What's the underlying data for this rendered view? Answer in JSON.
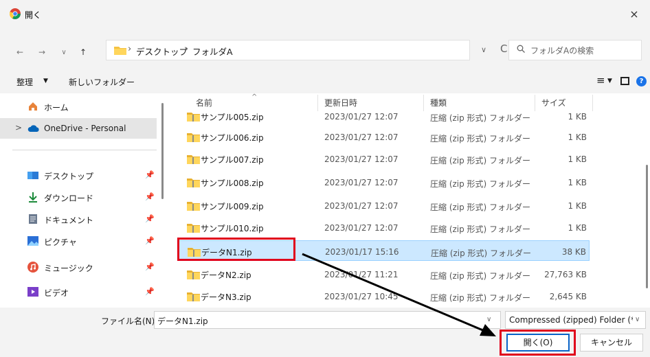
{
  "window": {
    "title": "開く",
    "close_glyph": "×"
  },
  "address": {
    "back": "←",
    "forward": "→",
    "recent": "∨",
    "up": "↑",
    "crumbs": [
      "デスクトップ",
      "フォルダA"
    ],
    "separator": "›",
    "dropdown": "∨",
    "refresh": "C",
    "search_placeholder": "フォルダAの検索"
  },
  "toolbar": {
    "organize": "整理",
    "organize_caret": "▼",
    "new_folder": "新しいフォルダー",
    "view_glyph": "≡",
    "view_caret": "▼",
    "help": "?"
  },
  "nav": {
    "items": [
      {
        "label": "ホーム",
        "icon": "home-icon"
      },
      {
        "label": "OneDrive - Personal",
        "icon": "cloud-icon",
        "expand": ">"
      },
      {
        "label": "デスクトップ",
        "icon": "desktop-icon",
        "pin": "📌"
      },
      {
        "label": "ダウンロード",
        "icon": "download-icon",
        "pin": "📌"
      },
      {
        "label": "ドキュメント",
        "icon": "document-icon",
        "pin": "📌"
      },
      {
        "label": "ピクチャ",
        "icon": "pictures-icon",
        "pin": "📌"
      },
      {
        "label": "ミュージック",
        "icon": "music-icon",
        "pin": "📌"
      },
      {
        "label": "ビデオ",
        "icon": "video-icon",
        "pin": "📌"
      }
    ]
  },
  "columns": {
    "name": "名前",
    "sort_arrow": "^",
    "date": "更新日時",
    "type": "種類",
    "size": "サイズ"
  },
  "files": [
    {
      "name": "サンプル005.zip",
      "date": "2023/01/27 12:07",
      "type": "圧縮 (zip 形式) フォルダー",
      "size": "1 KB"
    },
    {
      "name": "サンプル006.zip",
      "date": "2023/01/27 12:07",
      "type": "圧縮 (zip 形式) フォルダー",
      "size": "1 KB"
    },
    {
      "name": "サンプル007.zip",
      "date": "2023/01/27 12:07",
      "type": "圧縮 (zip 形式) フォルダー",
      "size": "1 KB"
    },
    {
      "name": "サンプル008.zip",
      "date": "2023/01/27 12:07",
      "type": "圧縮 (zip 形式) フォルダー",
      "size": "1 KB"
    },
    {
      "name": "サンプル009.zip",
      "date": "2023/01/27 12:07",
      "type": "圧縮 (zip 形式) フォルダー",
      "size": "1 KB"
    },
    {
      "name": "サンプル010.zip",
      "date": "2023/01/27 12:07",
      "type": "圧縮 (zip 形式) フォルダー",
      "size": "1 KB"
    },
    {
      "name": "データN1.zip",
      "date": "2023/01/17 15:16",
      "type": "圧縮 (zip 形式) フォルダー",
      "size": "38 KB",
      "selected": true
    },
    {
      "name": "データN2.zip",
      "date": "2023/01/27 11:21",
      "type": "圧縮 (zip 形式) フォルダー",
      "size": "27,763 KB"
    },
    {
      "name": "データN3.zip",
      "date": "2023/01/27 10:45",
      "type": "圧縮 (zip 形式) フォルダー",
      "size": "2,645 KB"
    }
  ],
  "bottom": {
    "filename_label": "ファイル名(N):",
    "filename_value": "データN1.zip",
    "dropdown": "∨",
    "filetype_value": "Compressed (zipped) Folder (*.z",
    "open_label": "開く(O)",
    "cancel_label": "キャンセル"
  },
  "colors": {
    "accent": "#0a64c8",
    "highlight": "#e0001b",
    "selection": "#cce8ff"
  }
}
